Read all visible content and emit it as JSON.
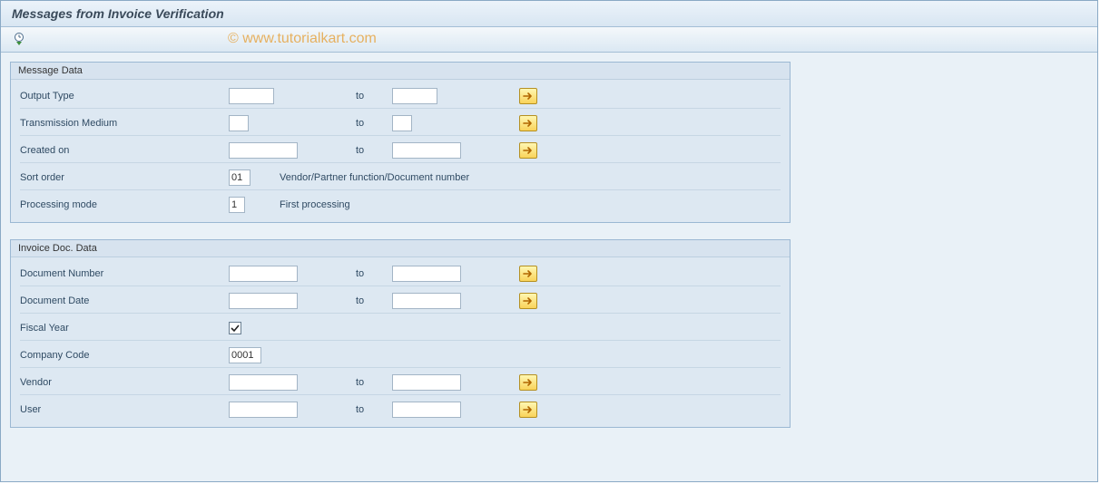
{
  "window": {
    "title": "Messages from Invoice Verification"
  },
  "watermark": "© www.tutorialkart.com",
  "labels": {
    "to": "to"
  },
  "section1": {
    "title": "Message Data",
    "output_type": {
      "label": "Output Type",
      "from": "",
      "to": ""
    },
    "trans_medium": {
      "label": "Transmission Medium",
      "from": "",
      "to": ""
    },
    "created_on": {
      "label": "Created on",
      "from": "",
      "to": ""
    },
    "sort_order": {
      "label": "Sort order",
      "value": "01",
      "desc": "Vendor/Partner function/Document number"
    },
    "proc_mode": {
      "label": "Processing mode",
      "value": "1",
      "desc": "First processing"
    }
  },
  "section2": {
    "title": "Invoice Doc. Data",
    "doc_number": {
      "label": "Document Number",
      "from": "",
      "to": ""
    },
    "doc_date": {
      "label": "Document Date",
      "from": "",
      "to": ""
    },
    "fiscal_year": {
      "label": "Fiscal Year",
      "checked": true
    },
    "company_code": {
      "label": "Company Code",
      "value": "0001"
    },
    "vendor": {
      "label": "Vendor",
      "from": "",
      "to": ""
    },
    "user": {
      "label": "User",
      "from": "",
      "to": ""
    }
  }
}
